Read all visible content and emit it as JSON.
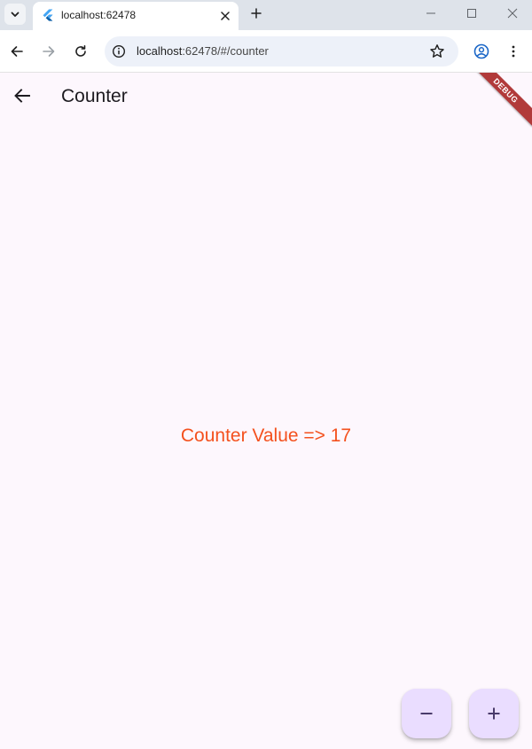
{
  "browser": {
    "tab": {
      "title": "localhost:62478",
      "favicon": "flutter-icon"
    },
    "address": {
      "host": "localhost",
      "rest": ":62478/#/counter"
    },
    "icons": {
      "tab_search": "chevron-down-icon",
      "tab_close": "close-icon",
      "new_tab": "plus-icon",
      "back": "arrow-left-icon",
      "forward": "arrow-right-icon",
      "reload": "reload-icon",
      "site_info": "info-icon",
      "bookmark": "star-icon",
      "profile": "account-icon",
      "menu": "kebab-menu-icon",
      "minimize": "minimize-icon",
      "maximize": "maximize-icon",
      "close_window": "close-icon"
    }
  },
  "app": {
    "appbar": {
      "title": "Counter",
      "back_icon": "arrow-back-icon"
    },
    "debug_banner": "DEBUG",
    "counter_text": "Counter Value => 17",
    "fabs": [
      {
        "name": "decrement",
        "icon": "minus-icon"
      },
      {
        "name": "increment",
        "icon": "plus-icon"
      }
    ]
  },
  "colors": {
    "background": "#fdf7fd",
    "counter_text": "#f4511e",
    "fab": "#eaddff",
    "fab_icon": "#4a3b6b",
    "debug_banner": "#b13a3a",
    "tabstrip": "#dee3ea",
    "omnibox": "#edf1f9",
    "profile_icon": "#1a66c7"
  }
}
